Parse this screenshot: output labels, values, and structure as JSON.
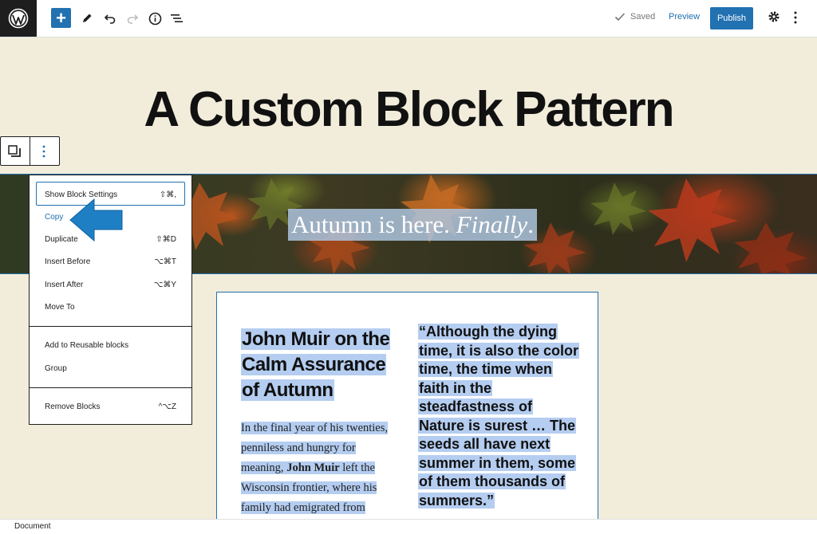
{
  "toolbar": {
    "saved_label": "Saved",
    "preview_label": "Preview",
    "publish_label": "Publish",
    "add_symbol": "+"
  },
  "page": {
    "title": "A Custom Block Pattern"
  },
  "cover": {
    "text_plain": "Autumn is here. ",
    "text_italic": "Finally",
    "text_end": "."
  },
  "columns": {
    "heading": "John Muir on the Calm Assurance of Autumn",
    "para_before": "In the final year of his twenties, penniless and hungry for meaning, ",
    "para_bold": "John Muir",
    "para_after": " left the Wisconsin frontier, where his family had emigrated from",
    "quote": "“Although the dying time, it is also the color time, the time when faith in the steadfastness of Nature is surest … The seeds all have next summer in them, some of them thousands of summers.”"
  },
  "menu": {
    "items": [
      {
        "label": "Show Block Settings",
        "shortcut": "⇧⌘,"
      },
      {
        "label": "Copy",
        "shortcut": ""
      },
      {
        "label": "Duplicate",
        "shortcut": "⇧⌘D"
      },
      {
        "label": "Insert Before",
        "shortcut": "⌥⌘T"
      },
      {
        "label": "Insert After",
        "shortcut": "⌥⌘Y"
      },
      {
        "label": "Move To",
        "shortcut": ""
      },
      {
        "label": "Add to Reusable blocks",
        "shortcut": ""
      },
      {
        "label": "Group",
        "shortcut": ""
      },
      {
        "label": "Remove Blocks",
        "shortcut": "^⌥Z"
      }
    ]
  },
  "footer": {
    "breadcrumb": "Document"
  },
  "colors": {
    "accent": "#2271b1",
    "selection": "#b4cdf0",
    "canvas": "#f2ecdb"
  }
}
